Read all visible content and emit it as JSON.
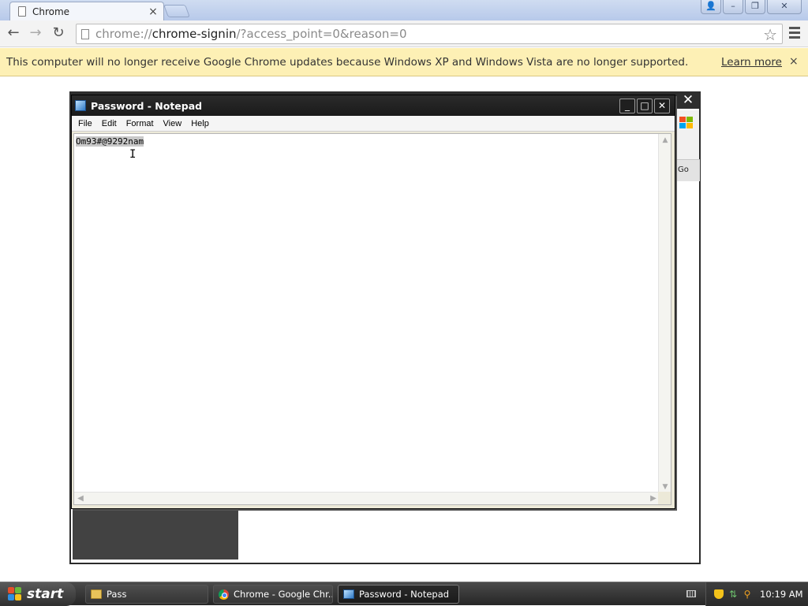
{
  "browser": {
    "tab_title": "Chrome",
    "tab_close": "×",
    "url_scheme": "chrome://",
    "url_host": "chrome-signin",
    "url_rest": "/?access_point=0&reason=0",
    "window_controls": {
      "profile": "👤",
      "minimize": "–",
      "restore": "❐",
      "close": "✕"
    }
  },
  "infobar": {
    "message": "This computer will no longer receive Google Chrome updates because Windows XP and Windows Vista are no longer supported.",
    "learn_more": "Learn more",
    "close": "×"
  },
  "background_window": {
    "go_label": "Go"
  },
  "notepad": {
    "title": "Password - Notepad",
    "menus": [
      "File",
      "Edit",
      "Format",
      "View",
      "Help"
    ],
    "content": "Om93#@9292nam",
    "controls": {
      "minimize": "_",
      "maximize": "□",
      "close": "✕"
    }
  },
  "taskbar": {
    "start_label": "start",
    "tasks": [
      "Pass",
      "Chrome - Google Chr...",
      "Password - Notepad"
    ],
    "clock": "10:19 AM"
  }
}
